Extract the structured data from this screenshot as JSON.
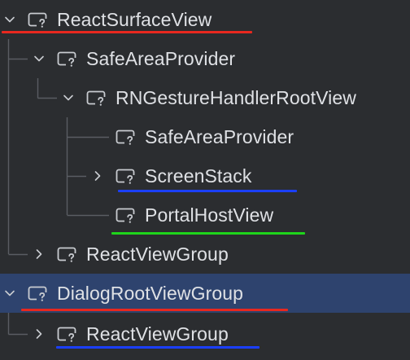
{
  "colors": {
    "background": "#2b2d30",
    "selected_row": "#2e436e",
    "text": "#dfe1e5",
    "guide_line": "#5a5d63",
    "underline_red": "#e8281f",
    "underline_blue": "#1b3fff",
    "underline_green": "#1fd51b"
  },
  "tree": {
    "nodes": [
      {
        "label": "ReactSurfaceView",
        "depth": 0,
        "chevron": "expanded",
        "icon": "view-icon",
        "underline": "red",
        "selected": false
      },
      {
        "label": "SafeAreaProvider",
        "depth": 1,
        "chevron": "expanded",
        "icon": "view-icon",
        "underline": null,
        "selected": false
      },
      {
        "label": "RNGestureHandlerRootView",
        "depth": 2,
        "chevron": "expanded",
        "icon": "view-icon",
        "underline": null,
        "selected": false
      },
      {
        "label": "SafeAreaProvider",
        "depth": 3,
        "chevron": null,
        "icon": "view-icon",
        "underline": null,
        "selected": false
      },
      {
        "label": "ScreenStack",
        "depth": 3,
        "chevron": "collapsed",
        "icon": "view-icon",
        "underline": "blue",
        "selected": false
      },
      {
        "label": "PortalHostView",
        "depth": 3,
        "chevron": null,
        "icon": "view-icon",
        "underline": "green",
        "selected": false
      },
      {
        "label": "ReactViewGroup",
        "depth": 1,
        "chevron": "collapsed",
        "icon": "view-icon",
        "underline": null,
        "selected": false
      },
      {
        "label": "DialogRootViewGroup",
        "depth": 0,
        "chevron": "expanded",
        "icon": "view-icon",
        "underline": "red",
        "selected": true
      },
      {
        "label": "ReactViewGroup",
        "depth": 1,
        "chevron": "collapsed",
        "icon": "view-icon",
        "underline": "blue",
        "selected": false
      }
    ]
  }
}
